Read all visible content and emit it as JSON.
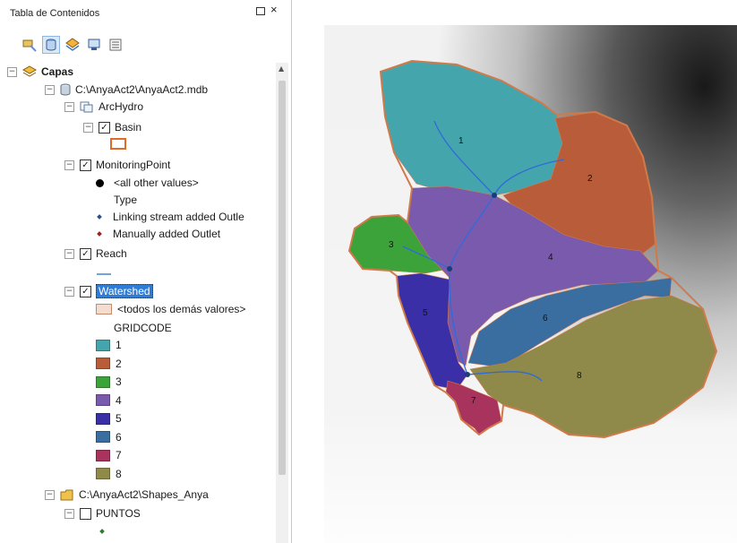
{
  "toc": {
    "title": "Tabla de Contenidos",
    "tree": {
      "layers_label": "Capas",
      "gdb_path": "C:\\AnyaAct2\\AnyaAct2.mdb",
      "archydro_label": "ArcHydro",
      "basin_label": "Basin",
      "monitoring_label": "MonitoringPoint",
      "all_other_values": "<all other values>",
      "type_header": "Type",
      "linking_outlet": "Linking stream added Outle",
      "manual_outlet": "Manually added Outlet",
      "reach_label": "Reach",
      "watershed_label": "Watershed",
      "todos_demas": "<todos los demás valores>",
      "gridcode_header": "GRIDCODE",
      "gridcodes": [
        {
          "label": "1",
          "color": "#45a5ad"
        },
        {
          "label": "2",
          "color": "#b85c3a"
        },
        {
          "label": "3",
          "color": "#3ca33a"
        },
        {
          "label": "4",
          "color": "#7a5aad"
        },
        {
          "label": "5",
          "color": "#3a2fa6"
        },
        {
          "label": "6",
          "color": "#3a6ea0"
        },
        {
          "label": "7",
          "color": "#a8345e"
        },
        {
          "label": "8",
          "color": "#8f8a4a"
        }
      ],
      "shapes_path": "C:\\AnyaAct2\\Shapes_Anya",
      "puntos_label": "PUNTOS"
    }
  },
  "map": {
    "watershed_labels": [
      "1",
      "2",
      "3",
      "4",
      "5",
      "6",
      "7",
      "8"
    ],
    "stream_color": "#2f6bd8",
    "outlet_color": "#1a3c78",
    "basin_outline_color": "#d07a4a"
  }
}
